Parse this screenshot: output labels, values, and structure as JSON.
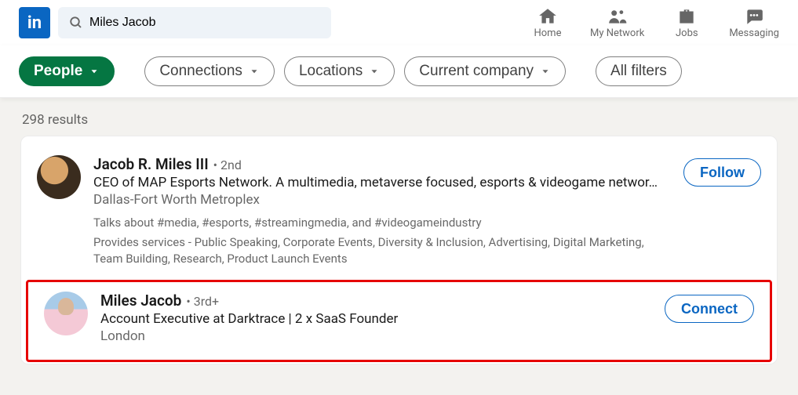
{
  "header": {
    "logo_text": "in",
    "search_value": "Miles Jacob",
    "nav": [
      {
        "label": "Home"
      },
      {
        "label": "My Network"
      },
      {
        "label": "Jobs"
      },
      {
        "label": "Messaging"
      }
    ]
  },
  "filters": {
    "active": "People",
    "items": [
      "Connections",
      "Locations",
      "Current company"
    ],
    "all": "All filters"
  },
  "results": {
    "count_text": "298 results",
    "items": [
      {
        "name": "Jacob R. Miles III",
        "degree": "• 2nd",
        "headline": "CEO of MAP Esports Network. A multimedia, metaverse focused, esports & videogame networ…",
        "location": "Dallas-Fort Worth Metroplex",
        "talks": "Talks about #media, #esports, #streamingmedia, and #videogameindustry",
        "services": "Provides services - Public Speaking, Corporate Events, Diversity & Inclusion, Advertising, Digital Marketing, Team Building, Research, Product Launch Events",
        "action": "Follow"
      },
      {
        "name": "Miles Jacob",
        "degree": "• 3rd+",
        "headline": "Account Executive at Darktrace | 2 x SaaS Founder",
        "location": "London",
        "action": "Connect"
      }
    ]
  }
}
